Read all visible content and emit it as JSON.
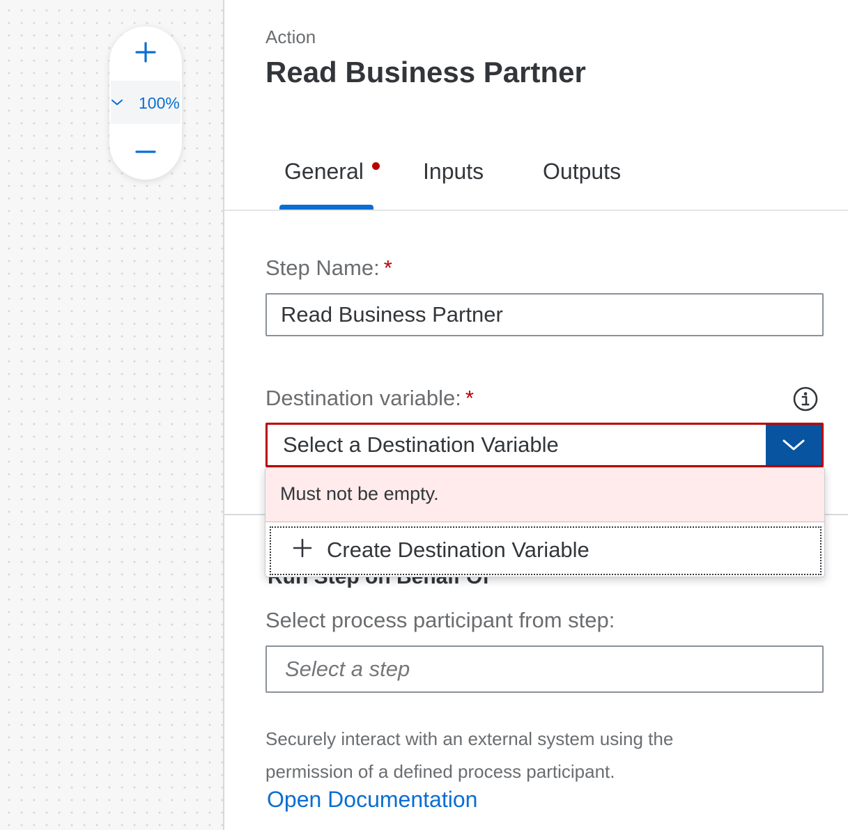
{
  "zoom": {
    "level": "100%"
  },
  "panel": {
    "subtitle": "Action",
    "title": "Read Business Partner",
    "tabs": [
      {
        "label": "General",
        "has_error_dot": true,
        "active": true
      },
      {
        "label": "Inputs"
      },
      {
        "label": "Outputs"
      }
    ]
  },
  "form": {
    "step_name_label": "Step Name:",
    "step_name_value": "Read Business Partner",
    "required_marker": "*",
    "destination_label": "Destination variable:",
    "destination_placeholder": "Select a Destination Variable",
    "dropdown_error": "Must not be empty.",
    "create_option": "Create Destination Variable",
    "participant_label": "Select process participant from step:",
    "participant_placeholder": "Select a step",
    "help_text": "Securely interact with an external system using the permission of a defined process participant.",
    "doc_link": "Open Documentation"
  },
  "colors": {
    "accent": "#0a6ed1",
    "dropdown_button": "#0854a0",
    "error": "#bb0000",
    "error_bg": "#ffebeb"
  }
}
